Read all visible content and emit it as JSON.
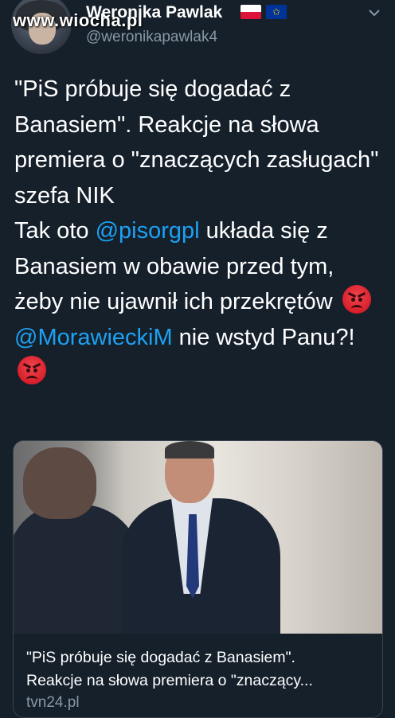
{
  "header": {
    "watermark": "www.wiocha.pl",
    "display_name": "Weronika Pawlak",
    "handle": "@weronikapawlak4",
    "flags": [
      "poland-flag-icon",
      "eu-flag-icon"
    ]
  },
  "tweet": {
    "text_intro": "\"PiS próbuje się dogadać z Banasiem\". Reakcje na słowa premiera o \"znaczących zasługach\" szefa NIK\nTak oto ",
    "mention1": "@pisorgpl",
    "text_mid": " układa się z Banasiem w obawie przed tym, żeby nie ujawnił ich przekrętów ",
    "mention2": "@MorawieckiM",
    "text_end": " nie wstyd Panu?! ",
    "emoji": "angry-face-icon"
  },
  "card": {
    "title_line1": "\"PiS próbuje się dogadać z Banasiem\".",
    "title_line2": "Reakcje na słowa premiera o \"znaczący...",
    "domain": "tvn24.pl"
  },
  "colors": {
    "background": "#15202b",
    "link": "#1da1f2",
    "secondary_text": "#8899a6"
  }
}
